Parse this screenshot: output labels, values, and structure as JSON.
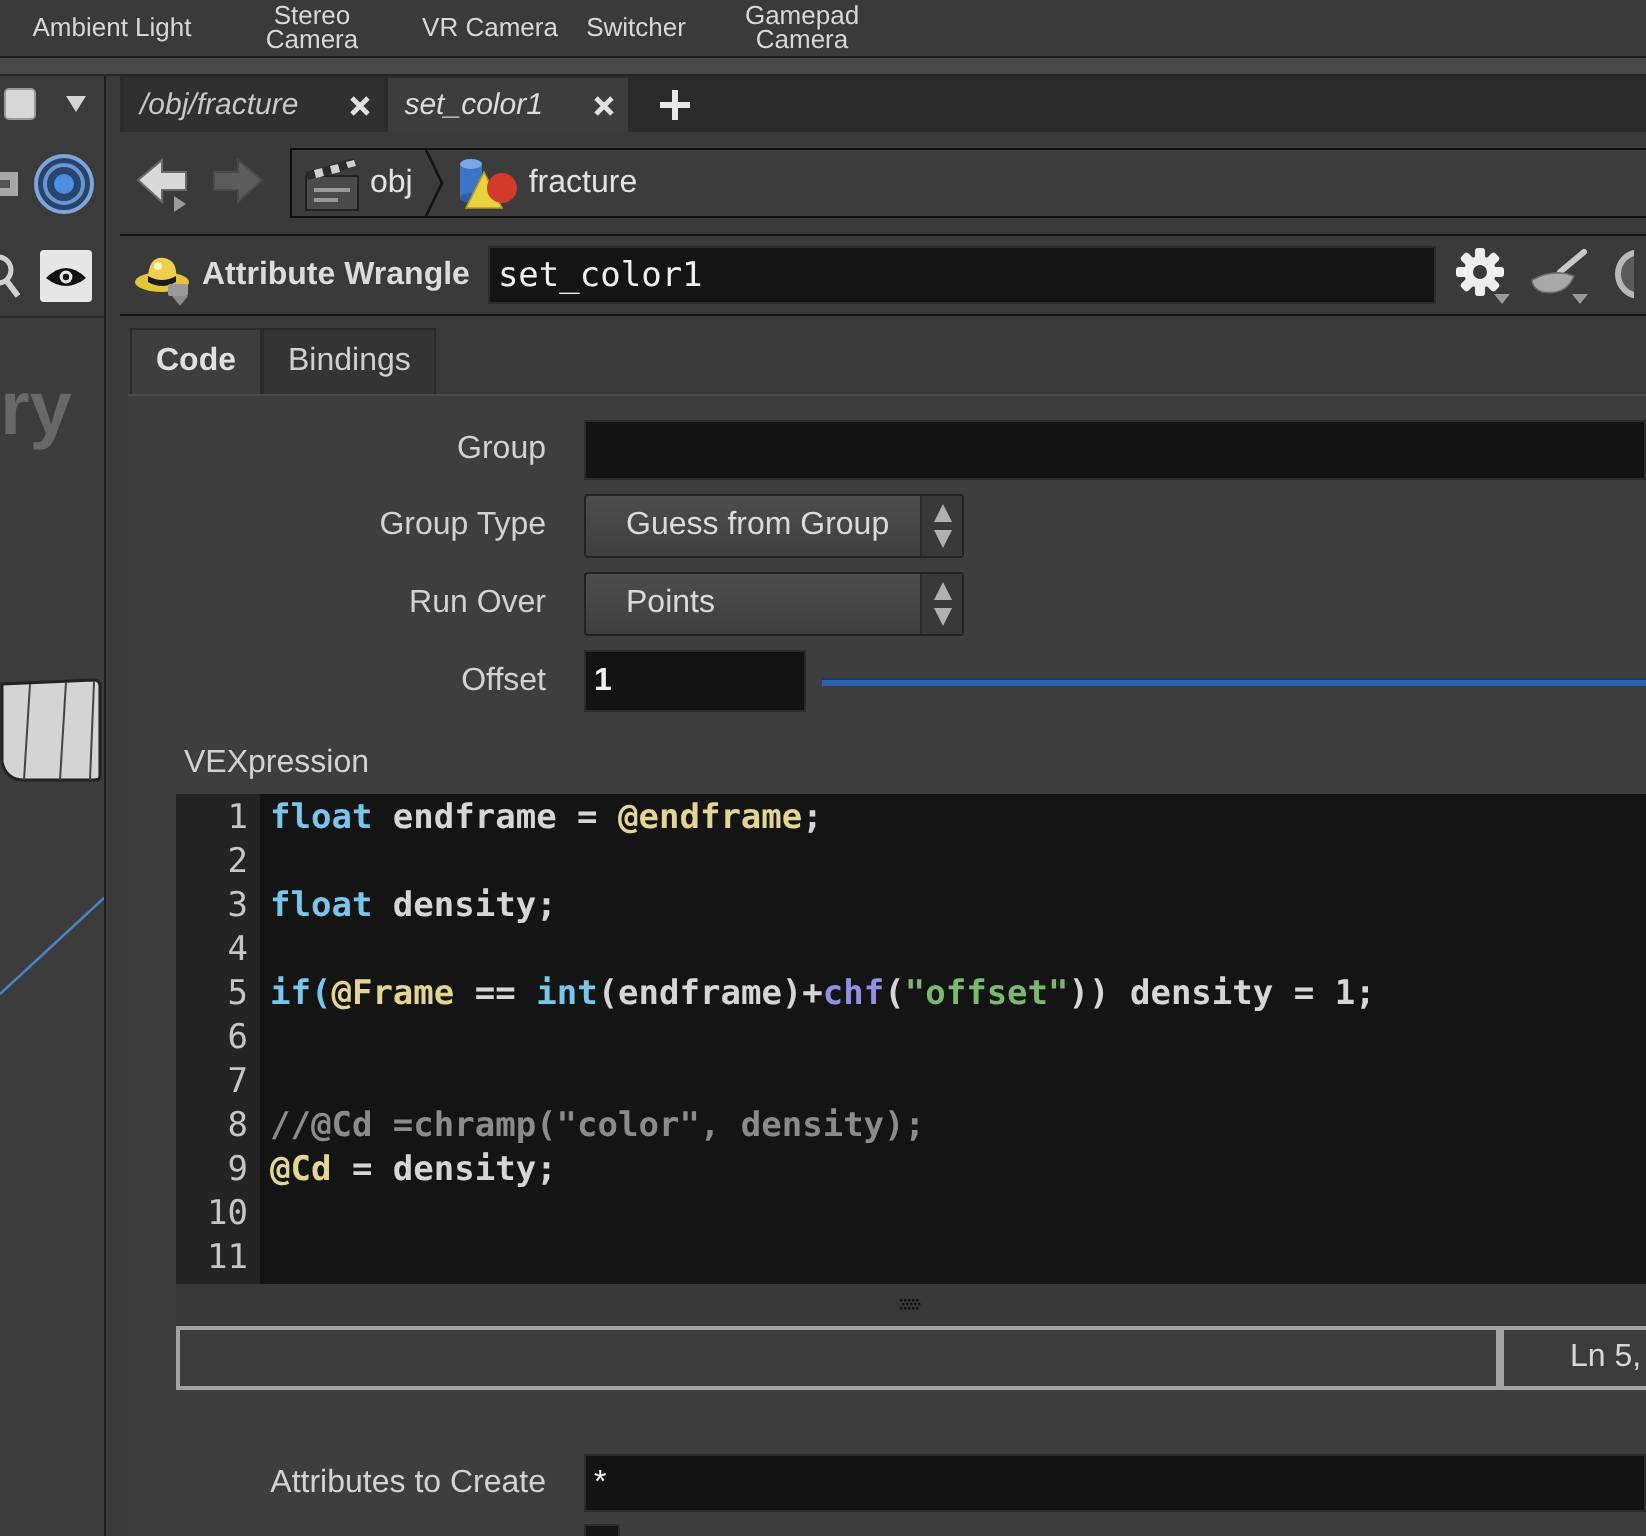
{
  "shelf": {
    "tools": [
      {
        "label": "Ambient Light"
      },
      {
        "label": "Stereo Camera"
      },
      {
        "label": "VR Camera"
      },
      {
        "label": "Switcher"
      },
      {
        "label": "Gamepad Camera"
      }
    ]
  },
  "left_pane": {
    "viewport_label": "ry"
  },
  "tabs": [
    {
      "label": "/obj/fracture",
      "selected": false
    },
    {
      "label": "set_color1",
      "selected": true
    }
  ],
  "nav": {
    "back": {
      "disabled": false
    },
    "forward": {
      "disabled": true
    }
  },
  "path": [
    {
      "kind": "object",
      "label": "obj"
    },
    {
      "kind": "geometry",
      "label": "fracture"
    }
  ],
  "node": {
    "type": "Attribute Wrangle",
    "name": "set_color1"
  },
  "parameter_tabs": [
    {
      "label": "Code",
      "selected": true
    },
    {
      "label": "Bindings",
      "selected": false
    }
  ],
  "parameters": [
    {
      "kind": "text",
      "label": "Group"
    },
    {
      "kind": "menu",
      "label": "Group Type",
      "value": "Guess from Group"
    },
    {
      "kind": "menu",
      "label": "Run Over",
      "value": "Points"
    },
    {
      "kind": "slider",
      "label": "Offset",
      "value": "1"
    }
  ],
  "vexpression": {
    "label": "VEXpression",
    "lines": [
      {
        "number": "1",
        "tokens": [
          {
            "kind": "keyword",
            "text": "float"
          },
          {
            "kind": "plain",
            "text": " endframe = "
          },
          {
            "kind": "attribute",
            "text": "@endframe"
          },
          {
            "kind": "plain",
            "text": ";"
          }
        ]
      },
      {
        "number": "2"
      },
      {
        "number": "3",
        "tokens": [
          {
            "kind": "keyword",
            "text": "float"
          },
          {
            "kind": "plain",
            "text": " density;"
          }
        ]
      },
      {
        "number": "4"
      },
      {
        "number": "5",
        "tokens": [
          {
            "kind": "keyword",
            "text": "if("
          },
          {
            "kind": "attribute",
            "text": "@Frame"
          },
          {
            "kind": "plain",
            "text": " == "
          },
          {
            "kind": "keyword",
            "text": "int"
          },
          {
            "kind": "plain",
            "text": "(endframe)+"
          },
          {
            "kind": "function",
            "text": "chf"
          },
          {
            "kind": "plain",
            "text": "("
          },
          {
            "kind": "string",
            "text": "\"offset\""
          },
          {
            "kind": "plain",
            "text": ")) density = 1;"
          }
        ]
      },
      {
        "number": "6"
      },
      {
        "number": "7"
      },
      {
        "number": "8",
        "tokens": [
          {
            "kind": "comment",
            "text": "//@Cd =chramp(\"color\", density);"
          }
        ]
      },
      {
        "number": "9",
        "tokens": [
          {
            "kind": "attribute",
            "text": "@Cd"
          },
          {
            "kind": "plain",
            "text": " = density;"
          }
        ]
      },
      {
        "number": "10"
      },
      {
        "number": "11"
      }
    ],
    "status": "Ln 5,"
  },
  "attributes_to_create": {
    "label": "Attributes to Create",
    "value": "*"
  },
  "next_toggle": {
    "checked": false
  }
}
